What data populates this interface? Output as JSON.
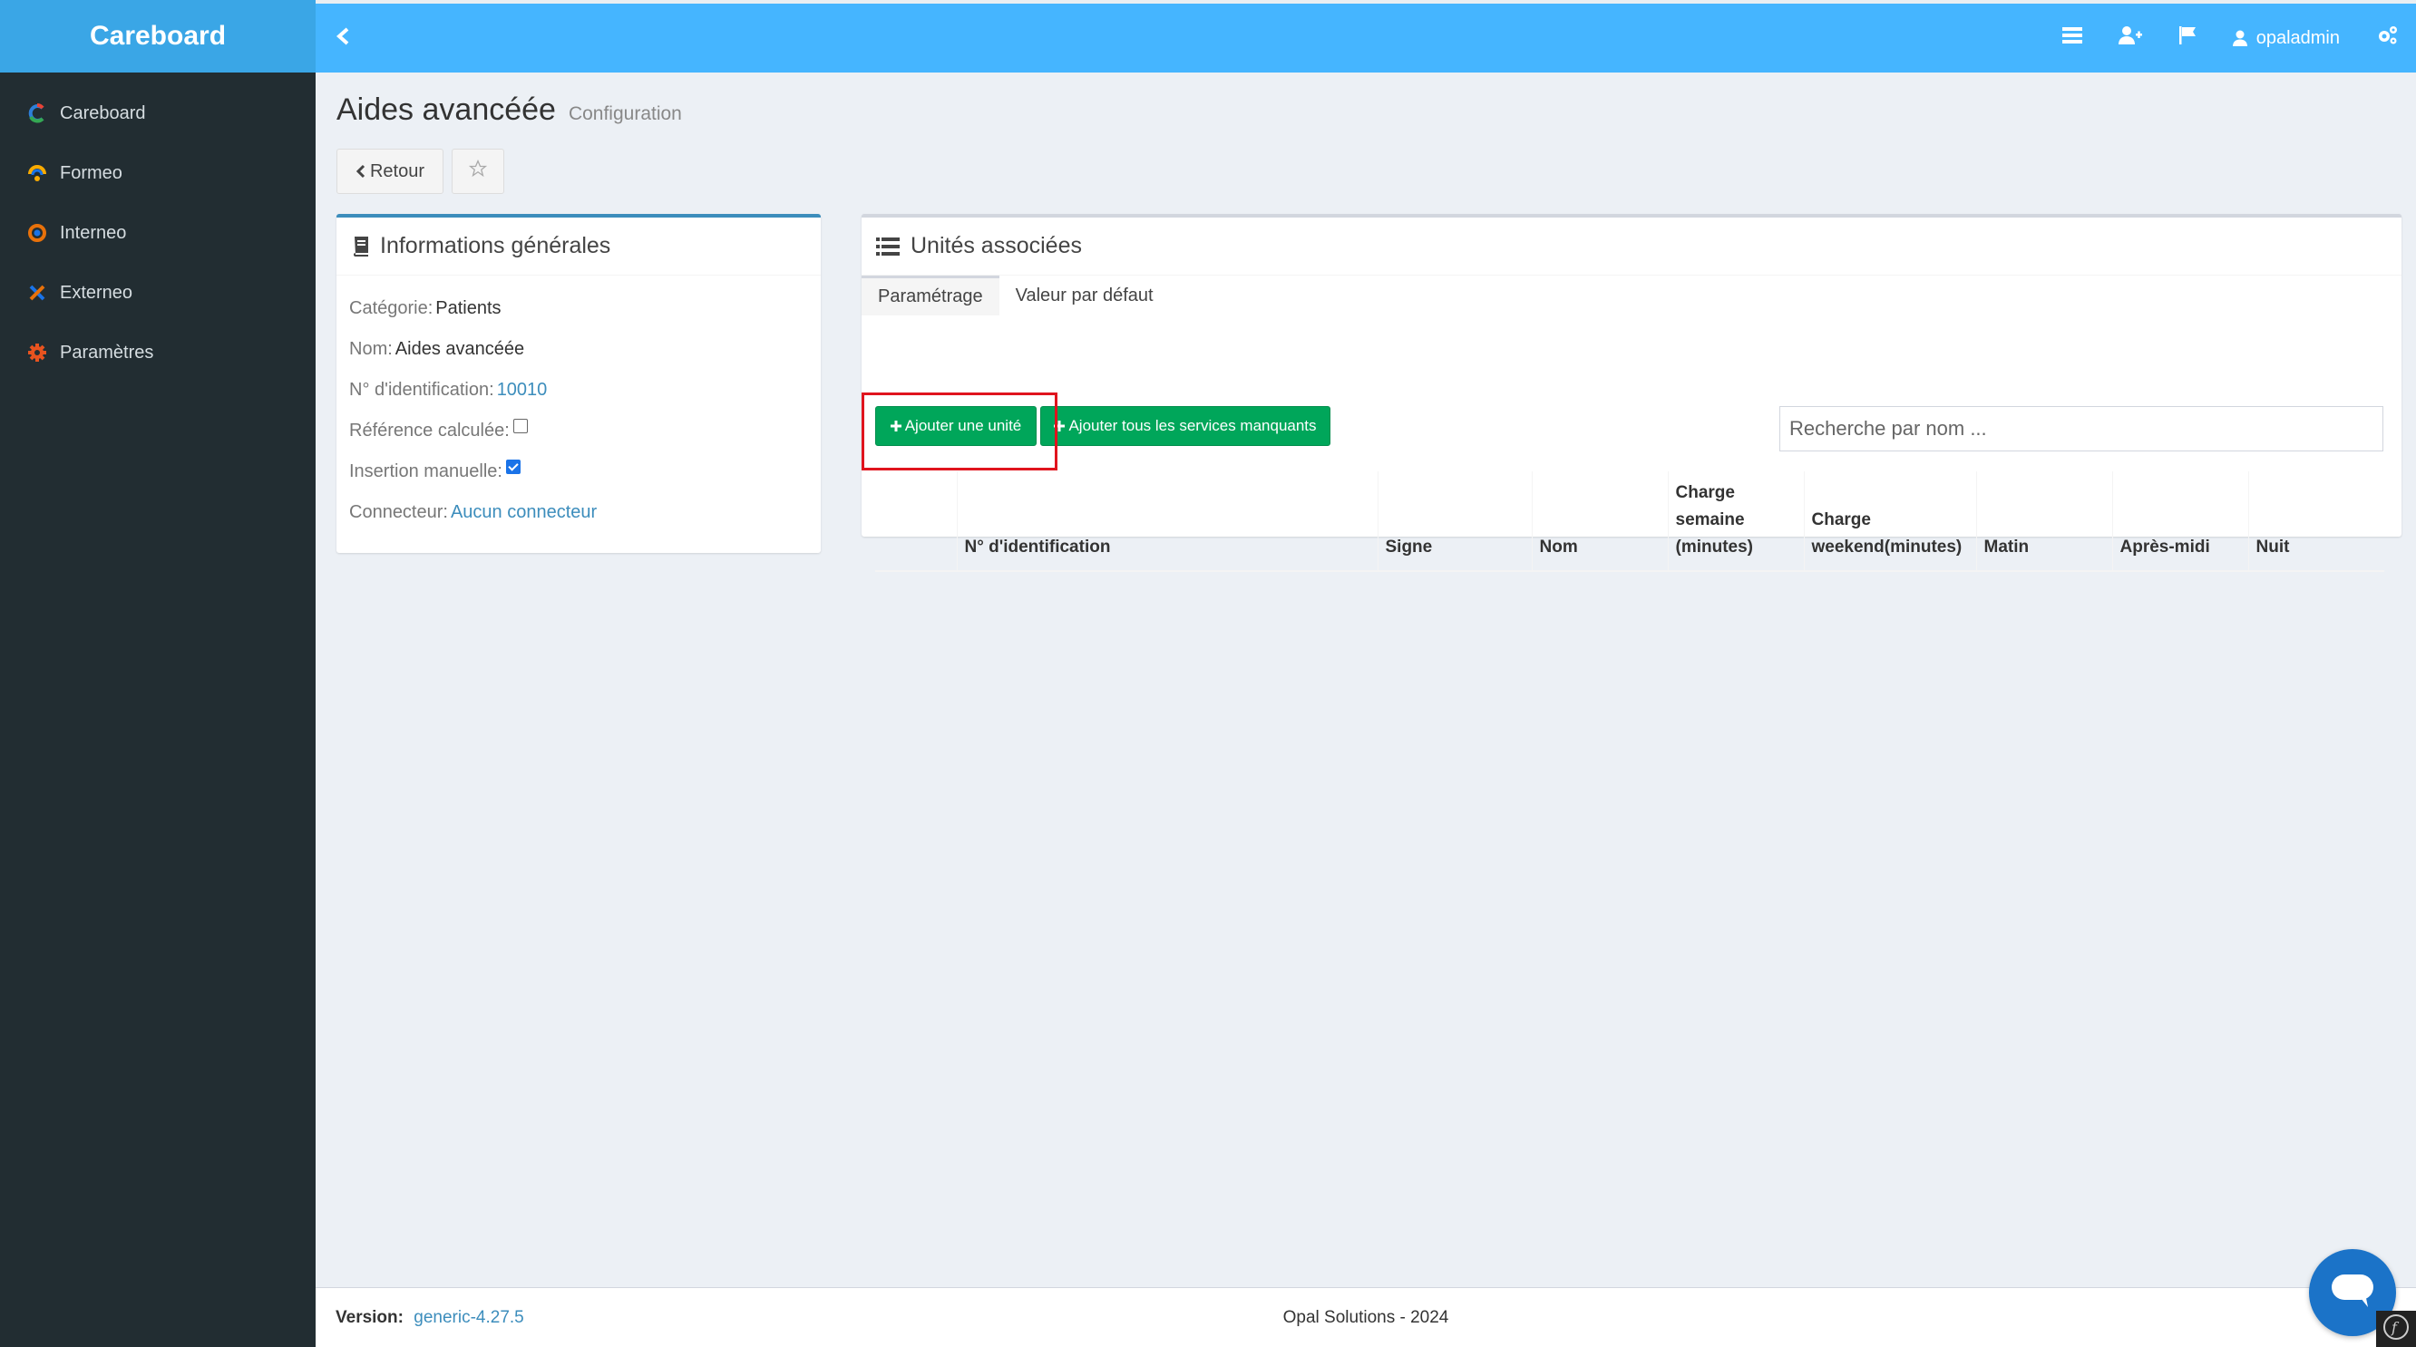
{
  "sidebar": {
    "logo": "Careboard",
    "items": [
      {
        "label": "Careboard",
        "icon": "careboard-c-icon"
      },
      {
        "label": "Formeo",
        "icon": "formeo-icon"
      },
      {
        "label": "Interneo",
        "icon": "interneo-icon"
      },
      {
        "label": "Externeo",
        "icon": "externeo-icon"
      },
      {
        "label": "Paramètres",
        "icon": "gear-icon"
      }
    ]
  },
  "topbar": {
    "user": "opaladmin",
    "icons": [
      "list-icon",
      "user-plus-icon",
      "flag-icon",
      "user-icon",
      "cogs-icon"
    ]
  },
  "page": {
    "title": "Aides avancéée",
    "subtitle": "Configuration",
    "back_label": "Retour"
  },
  "info": {
    "header": "Informations générales",
    "category_label": "Catégorie:",
    "category_value": "Patients",
    "name_label": "Nom:",
    "name_value": "Aides avancéée",
    "id_label": "N° d'identification:",
    "id_value": "10010",
    "ref_label": "Référence calculée:",
    "ref_checked": false,
    "manual_label": "Insertion manuelle:",
    "manual_checked": true,
    "connector_label": "Connecteur:",
    "connector_value": "Aucun connecteur"
  },
  "units": {
    "header": "Unités associées",
    "tabs": [
      "Paramétrage",
      "Valeur par défaut"
    ],
    "active_tab": 0,
    "add_unit_label": "Ajouter une unité",
    "add_all_label": "Ajouter tous les services manquants",
    "search_placeholder": "Recherche par nom ...",
    "columns": [
      "",
      "N° d'identification",
      "Signe",
      "Nom",
      "Charge semaine (minutes)",
      "Charge weekend(minutes)",
      "Matin",
      "Après-midi",
      "Nuit"
    ]
  },
  "footer": {
    "version_label": "Version:",
    "version_value": "generic-4.27.5",
    "copyright": "Opal Solutions - 2024"
  },
  "colors": {
    "sidebar_bg": "#222d32",
    "topbar_bg": "#45b5ff",
    "success": "#00a65a",
    "highlight": "#e0141e",
    "link": "#3c8dbc"
  }
}
